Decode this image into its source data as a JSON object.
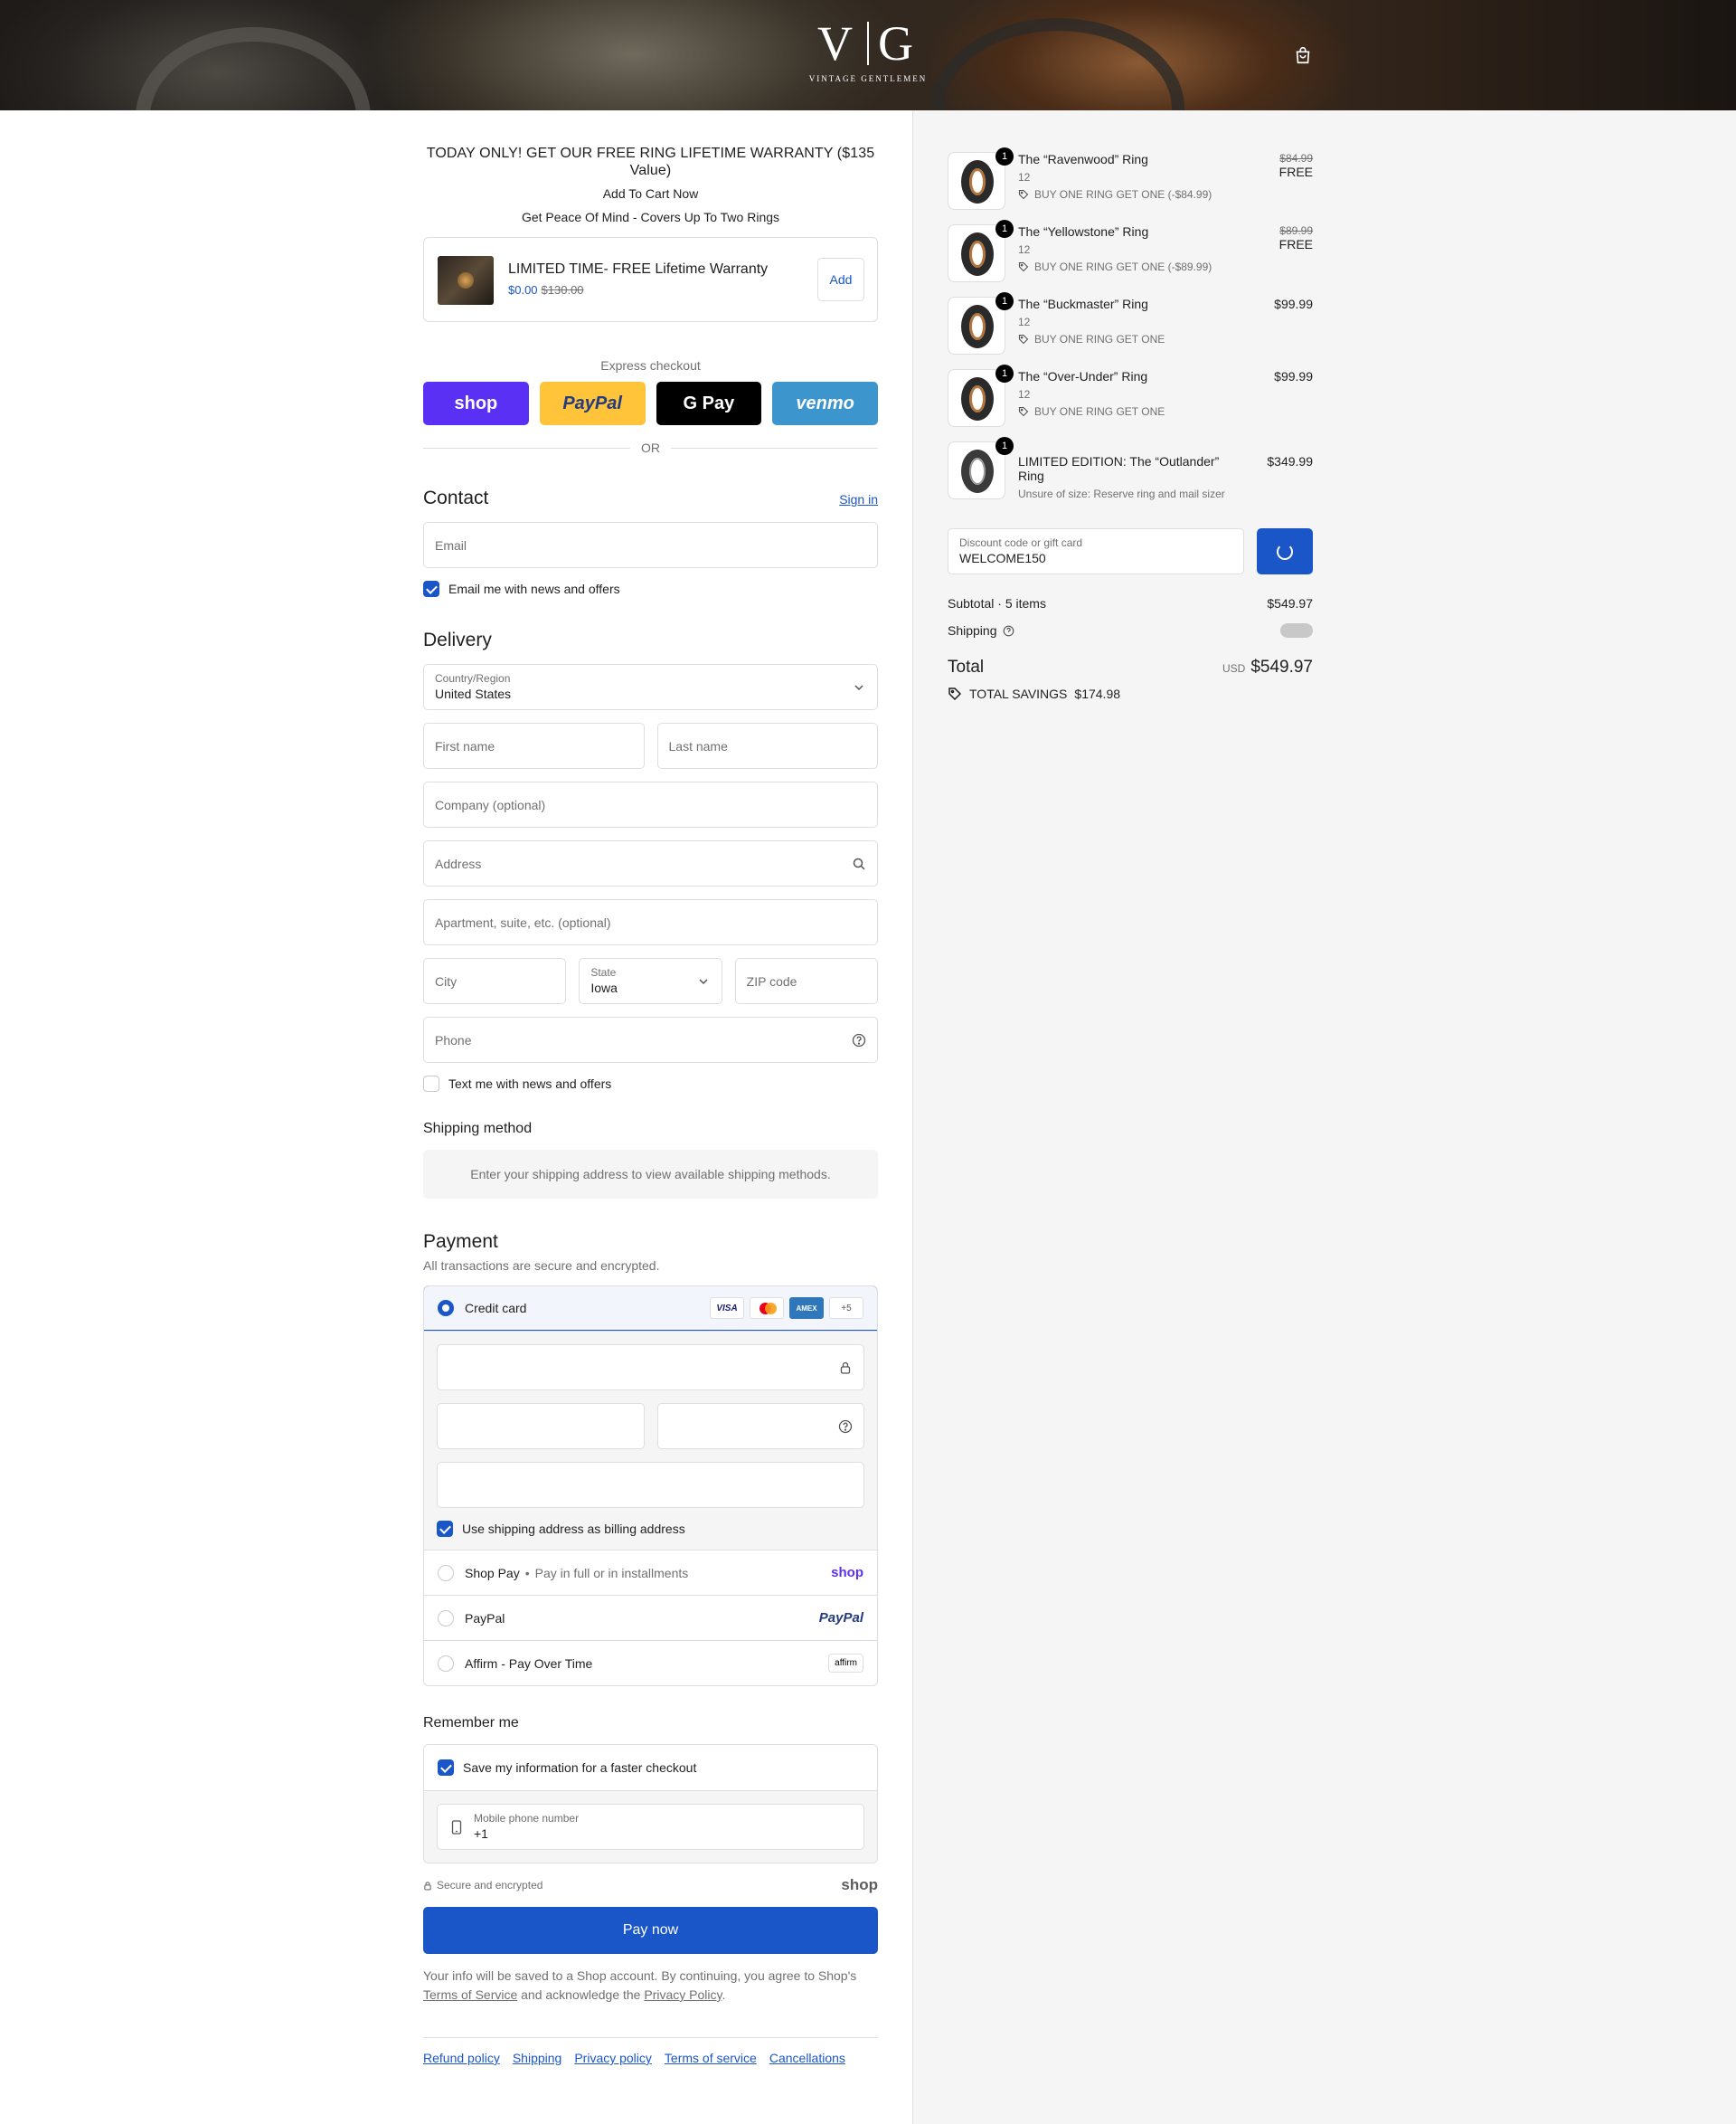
{
  "header": {
    "logo_left": "V",
    "logo_right": "G",
    "logo_sub": "VINTAGE GENTLEMEN"
  },
  "promo": {
    "headline": "TODAY ONLY! GET OUR FREE RING LIFETIME WARRANTY ($135 Value)",
    "line1": "Add To Cart Now",
    "line2": "Get Peace Of Mind - Covers Up To Two Rings"
  },
  "upsell": {
    "title": "LIMITED TIME- FREE Lifetime Warranty",
    "price": "$0.00",
    "compare_price": "$130.00",
    "add_label": "Add"
  },
  "express": {
    "label": "Express checkout",
    "shop": "shop",
    "paypal": "PayPal",
    "gpay": "G Pay",
    "venmo": "venmo",
    "or": "OR"
  },
  "contact": {
    "title": "Contact",
    "sign_in": "Sign in",
    "email_placeholder": "Email",
    "news_label": "Email me with news and offers"
  },
  "delivery": {
    "title": "Delivery",
    "country_label": "Country/Region",
    "country_value": "United States",
    "first_name": "First name",
    "last_name": "Last name",
    "company": "Company (optional)",
    "address": "Address",
    "apartment": "Apartment, suite, etc. (optional)",
    "city": "City",
    "state_label": "State",
    "state_value": "Iowa",
    "zip": "ZIP code",
    "phone": "Phone",
    "text_label": "Text me with news and offers"
  },
  "shipping_method": {
    "title": "Shipping method",
    "note": "Enter your shipping address to view available shipping methods."
  },
  "payment": {
    "title": "Payment",
    "subtitle": "All transactions are secure and encrypted.",
    "credit_card": "Credit card",
    "cards": [
      "VISA",
      "",
      "AMEX",
      "+5"
    ],
    "billing_label": "Use shipping address as billing address",
    "shop_pay": "Shop Pay",
    "shop_pay_sep": "•",
    "shop_pay_note": "Pay in full or in installments",
    "shop_brand": "shop",
    "paypal": "PayPal",
    "paypal_brand": "PayPal",
    "affirm": "Affirm - Pay Over Time",
    "affirm_brand": "affirm"
  },
  "remember": {
    "title": "Remember me",
    "save_label": "Save my information for a faster checkout",
    "phone_label": "Mobile phone number",
    "phone_value": "+1",
    "secure_text": "Secure and encrypted",
    "shop_word": "shop"
  },
  "pay_now": "Pay now",
  "legal": {
    "pre": "Your info will be saved to a Shop account. By continuing, you agree to Shop's",
    "tos": "Terms of Service",
    "mid": "and acknowledge the",
    "privacy": "Privacy Policy",
    "end": "."
  },
  "footer": [
    "Refund policy",
    "Shipping",
    "Privacy policy",
    "Terms of service",
    "Cancellations"
  ],
  "summary": {
    "items": [
      {
        "qty": "1",
        "name": "The “Ravenwood” Ring",
        "size": "12",
        "promo": "BUY ONE RING GET ONE (-$84.99)",
        "old": "$84.99",
        "price": "FREE"
      },
      {
        "qty": "1",
        "name": "The “Yellowstone” Ring",
        "size": "12",
        "promo": "BUY ONE RING GET ONE (-$89.99)",
        "old": "$89.99",
        "price": "FREE"
      },
      {
        "qty": "1",
        "name": "The “Buckmaster” Ring",
        "size": "12",
        "promo": "BUY ONE RING GET ONE",
        "old": "",
        "price": "$99.99"
      },
      {
        "qty": "1",
        "name": "The “Over-Under” Ring",
        "size": "12",
        "promo": "BUY ONE RING GET ONE",
        "old": "",
        "price": "$99.99"
      },
      {
        "qty": "1",
        "name": "LIMITED EDITION: The “Outlander” Ring",
        "size": "Unsure of size: Reserve ring and mail sizer",
        "promo": "",
        "old": "",
        "price": "$349.99"
      }
    ],
    "discount_label": "Discount code or gift card",
    "discount_value": "WELCOME150",
    "subtotal_label": "Subtotal · 5 items",
    "subtotal_value": "$549.97",
    "shipping_label": "Shipping",
    "total_label": "Total",
    "currency": "USD",
    "total_value": "$549.97",
    "savings_label": "TOTAL SAVINGS",
    "savings_value": "$174.98"
  },
  "colors": {
    "accent": "#1a56c8",
    "shop_purple": "#5a31f4",
    "paypal_yellow": "#ffc439",
    "venmo_blue": "#3d95ce"
  }
}
